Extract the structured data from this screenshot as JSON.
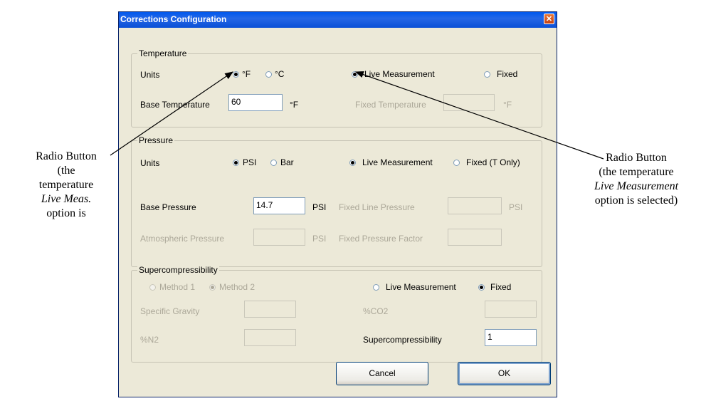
{
  "window": {
    "title": "Corrections Configuration",
    "close_icon": "close-icon"
  },
  "temperature": {
    "legend": "Temperature",
    "units_label": "Units",
    "unit_f": "°F",
    "unit_c": "°C",
    "live_label": "Live Measurement",
    "fixed_label": "Fixed",
    "base_label": "Base Temperature",
    "base_value": "60",
    "base_unit": "°F",
    "fixed_temp_label": "Fixed Temperature",
    "fixed_temp_value": "",
    "fixed_temp_unit": "°F",
    "unit_selected": "F",
    "mode_selected": "Live Measurement"
  },
  "pressure": {
    "legend": "Pressure",
    "units_label": "Units",
    "unit_psi": "PSI",
    "unit_bar": "Bar",
    "live_label": "Live Measurement",
    "fixed_label": "Fixed (T Only)",
    "base_label": "Base Pressure",
    "base_value": "14.7",
    "base_unit": "PSI",
    "fixed_line_label": "Fixed Line Pressure",
    "fixed_line_value": "",
    "fixed_line_unit": "PSI",
    "atm_label": "Atmospheric Pressure",
    "atm_value": "",
    "atm_unit": "PSI",
    "factor_label": "Fixed Pressure Factor",
    "factor_value": "",
    "unit_selected": "PSI",
    "mode_selected": "Live Measurement"
  },
  "supercompressibility": {
    "legend": "Supercompressibility",
    "method1_label": "Method 1",
    "method2_label": "Method 2",
    "live_label": "Live Measurement",
    "fixed_label": "Fixed",
    "sg_label": "Specific Gravity",
    "sg_value": "",
    "co2_label": "%CO2",
    "co2_value": "",
    "n2_label": "%N2",
    "n2_value": "",
    "super_label": "Supercompressibility",
    "super_value": "1",
    "method_selected": "Method 2",
    "mode_selected": "Fixed"
  },
  "buttons": {
    "cancel": "Cancel",
    "ok": "OK"
  },
  "annotations": {
    "left_line1": "Radio Button",
    "left_line2": "(the",
    "left_line3": "temperature",
    "left_line4": "Live Meas.",
    "left_line5": "option is",
    "right_line1": "Radio Button",
    "right_line2": "(the temperature",
    "right_line3": "Live Measurement",
    "right_line4": "option is selected)"
  }
}
